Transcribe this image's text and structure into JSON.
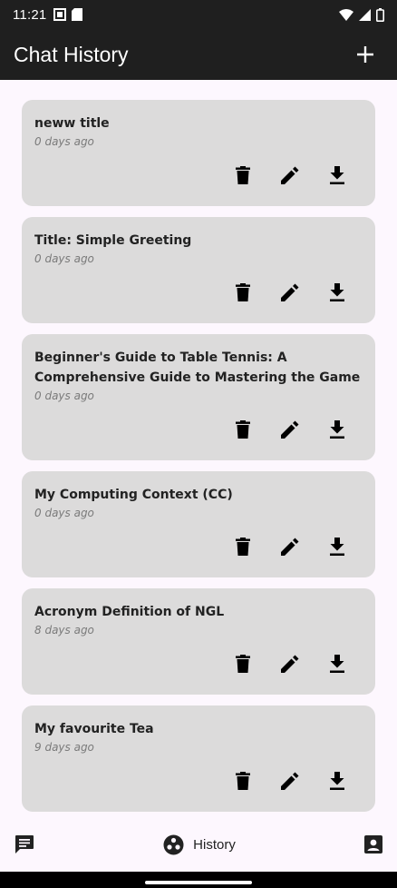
{
  "status_bar": {
    "time": "11:21",
    "icons": [
      "screen-icon",
      "sd-card-icon",
      "wifi-icon",
      "signal-icon",
      "battery-icon"
    ]
  },
  "app_bar": {
    "title": "Chat History",
    "add_icon": "plus-icon"
  },
  "chats": [
    {
      "title": "neww title",
      "date": "0 days ago"
    },
    {
      "title": "Title: Simple Greeting",
      "date": "0 days ago"
    },
    {
      "title": "Beginner's Guide to Table Tennis: A Comprehensive Guide to Mastering the Game",
      "date": "0 days ago"
    },
    {
      "title": "My Computing Context (CC)",
      "date": "0 days ago"
    },
    {
      "title": "Acronym Definition of NGL",
      "date": "8 days ago"
    },
    {
      "title": "My favourite Tea",
      "date": "9 days ago"
    }
  ],
  "card_actions": [
    "delete-icon",
    "edit-icon",
    "download-icon"
  ],
  "bottom_nav": {
    "chat_icon": "chat-icon",
    "history_label": "History",
    "history_icon": "history-icon",
    "profile_icon": "profile-icon"
  },
  "colors": {
    "bar_bg": "#1f1f1f",
    "page_bg": "#fdf7fe",
    "card_bg": "#dcdbdb"
  }
}
